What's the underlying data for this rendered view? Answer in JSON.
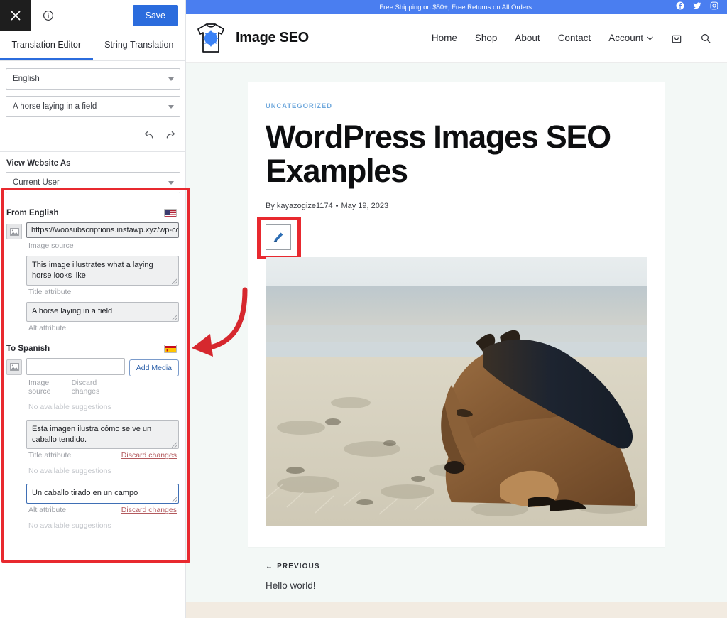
{
  "sidebar": {
    "toolbar": {
      "close_icon": "close-icon",
      "info_icon": "info-icon",
      "save_label": "Save"
    },
    "tabs": [
      {
        "label": "Translation Editor",
        "active": true
      },
      {
        "label": "String Translation",
        "active": false
      }
    ],
    "language_select": {
      "value": "English",
      "icon": "chevron-down-icon"
    },
    "string_select": {
      "value": "A horse laying in a field",
      "icon": "chevron-down-icon"
    },
    "history": {
      "undo_icon": "undo-icon",
      "redo_icon": "redo-icon"
    },
    "view_website_as": {
      "label": "View Website As",
      "select_value": "Current User",
      "icon": "chevron-down-icon"
    },
    "source": {
      "heading": "From English",
      "flag": "us-flag-icon",
      "image_source": {
        "value": "https://woosubscriptions.instawp.xyz/wp-conter",
        "label": "Image source",
        "icon": "image-placeholder-icon"
      },
      "title_attribute": {
        "value": "This image illustrates what a laying horse looks like",
        "label": "Title attribute"
      },
      "alt_attribute": {
        "value": "A horse laying in a field",
        "label": "Alt attribute"
      }
    },
    "target": {
      "heading": "To Spanish",
      "flag": "es-flag-icon",
      "add_media_label": "Add Media",
      "image_source": {
        "value": "",
        "placeholder": "",
        "label": "Image source",
        "discard_label": "Discard changes",
        "suggestion": "No available suggestions",
        "icon": "image-placeholder-icon"
      },
      "title_attribute": {
        "value": "Esta imagen ilustra cómo se ve un caballo tendido.",
        "label": "Title attribute",
        "discard_label": "Discard changes",
        "suggestion": "No available suggestions"
      },
      "alt_attribute": {
        "value": "Un caballo tirado en un campo",
        "label": "Alt attribute",
        "discard_label": "Discard changes",
        "suggestion": "No available suggestions"
      }
    }
  },
  "site": {
    "topbar": {
      "message": "Free Shipping on $50+, Free Returns on All Orders.",
      "socials": [
        "facebook-icon",
        "twitter-icon",
        "instagram-icon"
      ]
    },
    "header": {
      "brand_name": "Image SEO",
      "logo_icon": "tshirt-logo-icon",
      "nav": [
        {
          "label": "Home"
        },
        {
          "label": "Shop"
        },
        {
          "label": "About"
        },
        {
          "label": "Contact"
        }
      ],
      "account": {
        "label": "Account",
        "icon": "chevron-down-icon"
      },
      "cart_icon": "shopping-bag-icon",
      "search_icon": "search-icon"
    },
    "post": {
      "category": "UNCATEGORIZED",
      "title": "WordPress Images SEO Examples",
      "author_prefix": "By",
      "author": "kayazogize1174",
      "separator": "•",
      "date": "May 19, 2023",
      "edit_icon": "pencil-edit-icon",
      "image_alt": "A horse laying in a field"
    },
    "post_nav": {
      "previous_label": "PREVIOUS",
      "previous_arrow": "arrow-left-icon",
      "previous_title": "Hello world!"
    }
  },
  "colors": {
    "accent_blue": "#2b6cdd",
    "banner_blue": "#4a7ef0",
    "highlight_red": "#e8292f",
    "category_blue": "#6fa8dc",
    "page_bg": "#f3f8f6",
    "footer_beige": "#f2ebe1"
  }
}
